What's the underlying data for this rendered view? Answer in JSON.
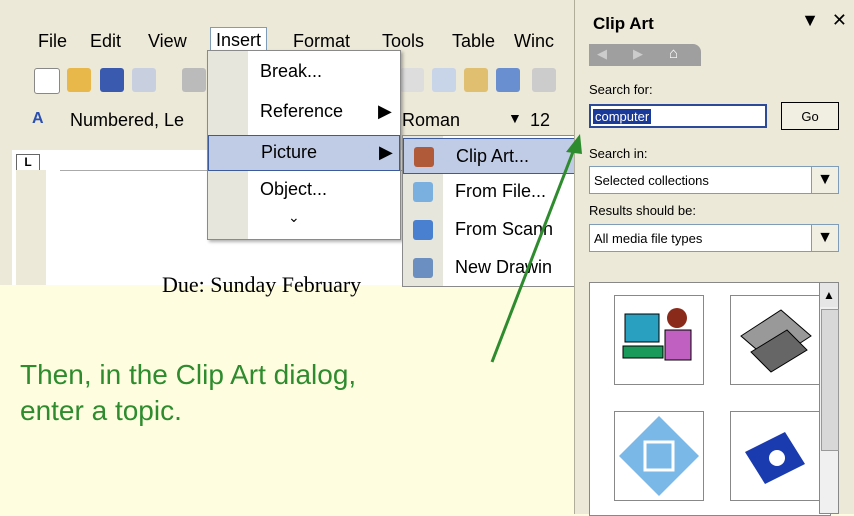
{
  "menubar": {
    "items": [
      "File",
      "Edit",
      "View",
      "Insert",
      "Format",
      "Tools",
      "Table",
      "Winc"
    ],
    "active": "Insert"
  },
  "formatting": {
    "style": "Numbered, Le",
    "font": "Roman",
    "size": "12"
  },
  "doc_text": "Due: Sunday February",
  "insert_menu": {
    "items": [
      "Break...",
      "Reference",
      "Picture",
      "Object..."
    ],
    "highlighted": "Picture"
  },
  "picture_submenu": {
    "items": [
      "Clip Art...",
      "From File...",
      "From Scann",
      "New Drawin"
    ],
    "highlighted": "Clip Art..."
  },
  "clip_art": {
    "title": "Clip Art",
    "search_for_label": "Search for:",
    "search_value": "computer",
    "go_label": "Go",
    "search_in_label": "Search in:",
    "search_in_value": "Selected collections",
    "results_label": "Results should be:",
    "results_value": "All media file types"
  },
  "caption": {
    "line1": "Then, in the Clip Art dialog,",
    "line2": "enter a topic."
  },
  "colors": {
    "caption": "#2e8b2e",
    "highlight": "#c0cce6",
    "arrow": "#2e8b2e"
  }
}
